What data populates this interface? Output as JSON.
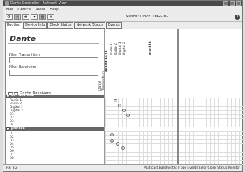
{
  "window": {
    "title": "Dante Controller - Network View"
  },
  "menu": [
    "File",
    "Device",
    "View",
    "Help"
  ],
  "toolbar": {
    "icons": [
      "refresh-icon",
      "device-icon",
      "star-icon",
      "filter-icon",
      "grid-icon",
      "plus-icon"
    ]
  },
  "clock": {
    "text": "Master Clock: DIGI-IN-... ... ...."
  },
  "help_glyph": "?",
  "tabs": [
    "Routing",
    "Device Info",
    "Clock Status",
    "Network Status",
    "Events"
  ],
  "logo": "Dante",
  "filter_transmitters_label": "Filter Transmitters",
  "filter_receivers_label": "Filter Receivers",
  "dante_receivers_label": "Dante Receivers",
  "dante_transmitters_label": "Dante Transmitters",
  "receiver_devices": [
    {
      "name": "BPT-NET-EX4",
      "channels": [
        "Radio 1",
        "Radio 2",
        "Digital 1",
        "Digital 2",
        "01",
        "02",
        "03",
        "04"
      ]
    },
    {
      "name": "pro-888",
      "channels": [
        "01",
        "02",
        "03",
        "04",
        "05",
        "06",
        "07",
        "08"
      ]
    }
  ],
  "transmitter_cols": [
    "BPT-NET-EX4",
    "Radio 1",
    "Radio 2",
    "Digital 1",
    "Digital 2",
    "pro-888"
  ],
  "status": {
    "left": "Rx: 3.2",
    "right": "Multicast Bandwidth: 0 bps   Events Error   Clock Status Monitor"
  }
}
